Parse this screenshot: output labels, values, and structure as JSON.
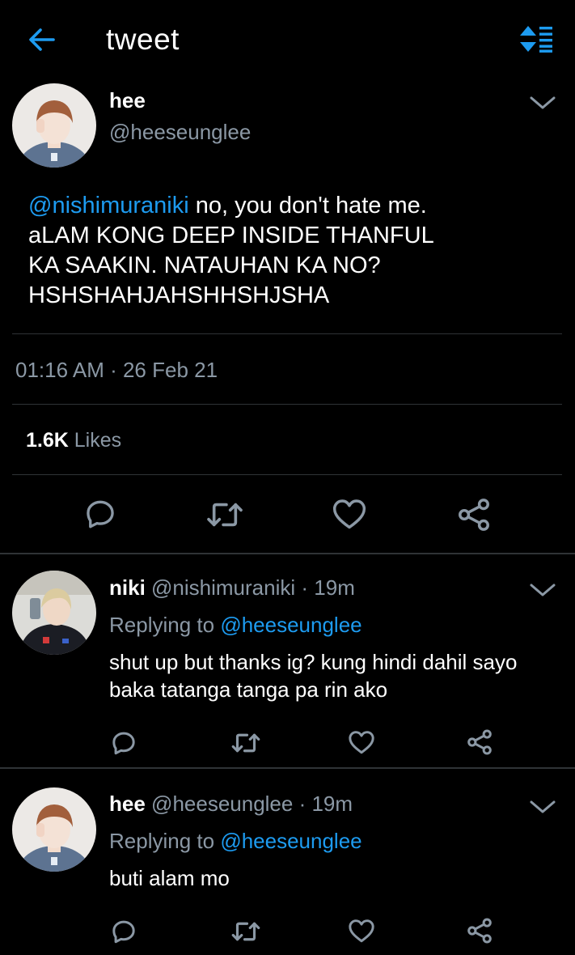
{
  "header": {
    "title": "tweet"
  },
  "tweet": {
    "name": "hee",
    "handle": "@heeseunglee",
    "mention": "@nishimuraniki",
    "text_first": " no, you don't hate me.",
    "text_lines": [
      "aLAM KONG DEEP INSIDE THANFUL",
      "KA SAAKIN. NATAUHAN KA NO?",
      "HSHSHAHJAHSHHSHJSHA"
    ],
    "timestamp": "01:16 AM · 26 Feb 21",
    "likes_count": "1.6K",
    "likes_label": "Likes"
  },
  "replies": [
    {
      "name": "niki",
      "handle": "@nishimuraniki",
      "age": "· 19m",
      "replying_label": "Replying to",
      "replying_to": "@heeseunglee",
      "text_lines": [
        "shut up but thanks ig? kung hindi dahil sayo",
        "baka tatanga tanga pa rin ako"
      ]
    },
    {
      "name": "hee",
      "handle": "@heeseunglee",
      "age": "· 19m",
      "replying_label": "Replying to",
      "replying_to": "@heeseunglee",
      "text_lines": [
        "buti alam mo"
      ]
    }
  ],
  "icons": {
    "back": "arrow-left-icon",
    "sort": "sort-icon",
    "reply": "comment-icon",
    "retweet": "retweet-icon",
    "like": "heart-icon",
    "share": "share-icon",
    "more": "chevron-down-icon"
  },
  "colors": {
    "accent": "#1d9bf0",
    "background": "#000000",
    "muted_text": "#8b98a5",
    "divider": "#2f3336"
  }
}
